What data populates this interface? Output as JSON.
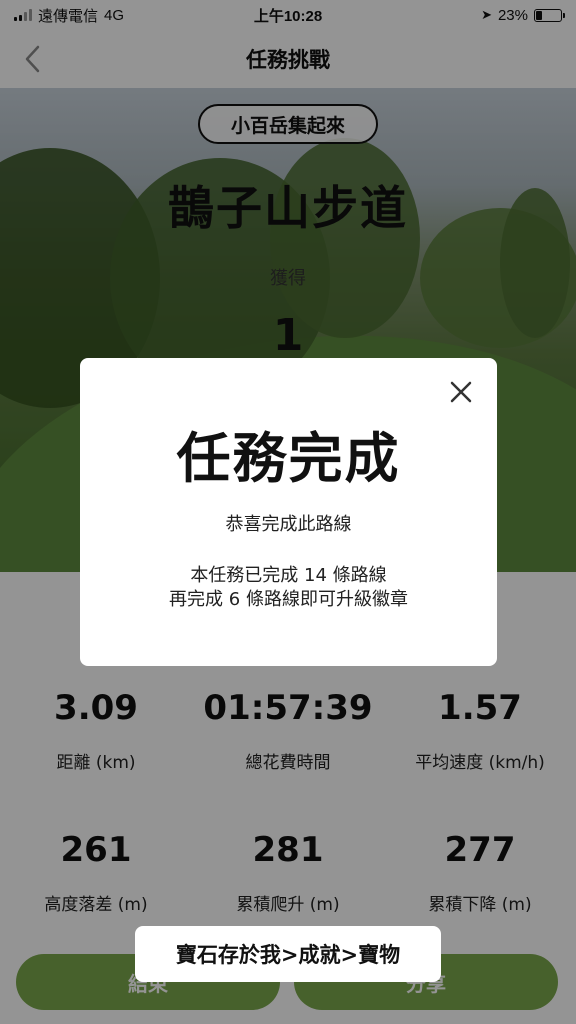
{
  "status_bar": {
    "carrier": "遠傳電信",
    "network": "4G",
    "time": "上午10:28",
    "battery": "23%",
    "battery_level": 0.23
  },
  "nav": {
    "title": "任務挑戰"
  },
  "hero": {
    "tag": "小百岳集起來",
    "title": "鵲子山步道",
    "subtitle": "獲得",
    "count": "1"
  },
  "stats": [
    {
      "value": "3.09",
      "label": "距離 (km)"
    },
    {
      "value": "01:57:39",
      "label": "總花費時間"
    },
    {
      "value": "1.57",
      "label": "平均速度 (km/h)"
    },
    {
      "value": "261",
      "label": "高度落差 (m)"
    },
    {
      "value": "281",
      "label": "累積爬升 (m)"
    },
    {
      "value": "277",
      "label": "累積下降 (m)"
    }
  ],
  "buttons": {
    "end": "結束",
    "share": "分享"
  },
  "modal": {
    "title": "任務完成",
    "message": "恭喜完成此路線",
    "detail_line1": "本任務已完成 14 條路線",
    "detail_line2": "再完成 6 條路線即可升級徽章"
  },
  "toast": {
    "text": "寶石存於我>成就>寶物"
  }
}
